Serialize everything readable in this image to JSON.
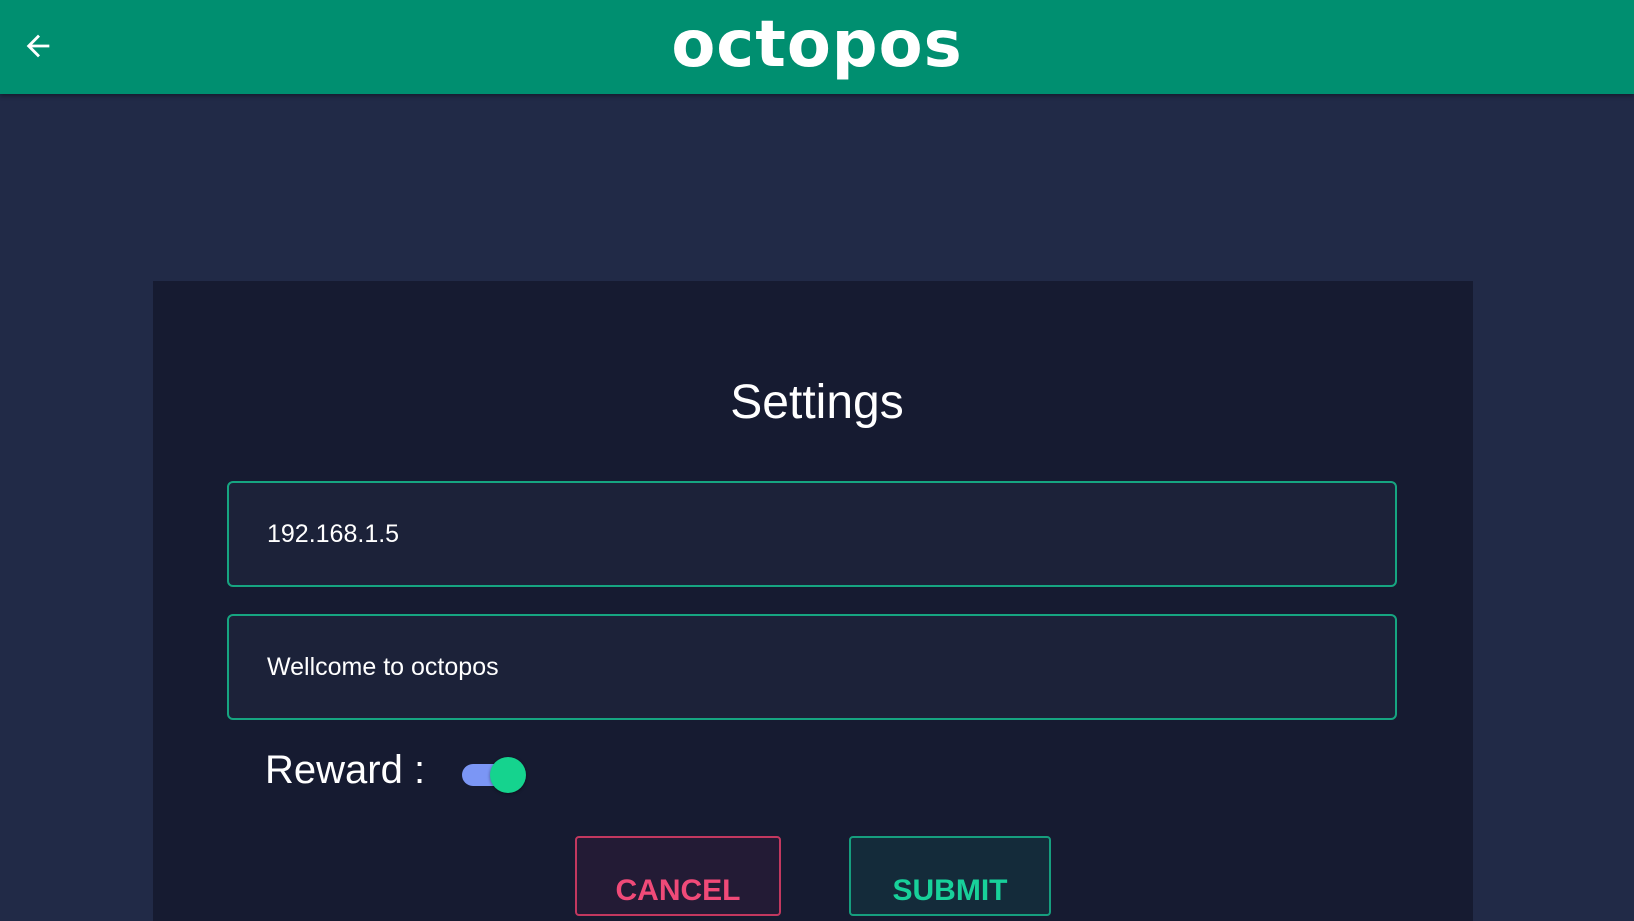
{
  "header": {
    "back_icon": "arrow-left-icon",
    "logo_text": "octopos",
    "colors": {
      "bar": "#008f70",
      "text": "#ffffff"
    }
  },
  "settings": {
    "title": "Settings",
    "ip_field": {
      "value": "192.168.1.5"
    },
    "message_field": {
      "value": "Wellcome to octopos"
    },
    "reward": {
      "label": "Reward :",
      "enabled": true
    },
    "cancel_label": "CANCEL",
    "submit_label": "SUBMIT"
  },
  "colors": {
    "background": "#212a47",
    "card": "#161b31",
    "accent": "#16a581",
    "cancel": "#f04a78",
    "submit": "#18d19a",
    "toggle_track": "#7b96f5",
    "toggle_thumb": "#15d38e"
  }
}
